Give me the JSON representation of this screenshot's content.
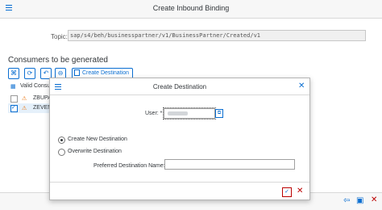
{
  "window": {
    "title": "Create Inbound Binding"
  },
  "topic": {
    "label": "Topic:",
    "value": "sap/s4/beh/businesspartner/v1/BusinessPartner/Created/v1"
  },
  "consumers": {
    "title": "Consumers to be generated",
    "toolbar": {
      "create_destination_label": "Create Destination"
    },
    "columns": {
      "valid": "Valid",
      "consumer": "Consu"
    },
    "rows": [
      {
        "name": "ZBUPA",
        "selected": false
      },
      {
        "name": "ZEVEN",
        "selected": true
      }
    ]
  },
  "dialog": {
    "title": "Create Destination",
    "user_label": "User: *",
    "options": [
      "Create New Destination",
      "Overwrite Destination"
    ],
    "selected_option": "Create New Destination",
    "preferred_label": "Preferred Destination Name:"
  },
  "colors": {
    "accent": "#0a6ed1",
    "warning": "#e9730c",
    "danger": "#bb0000"
  }
}
